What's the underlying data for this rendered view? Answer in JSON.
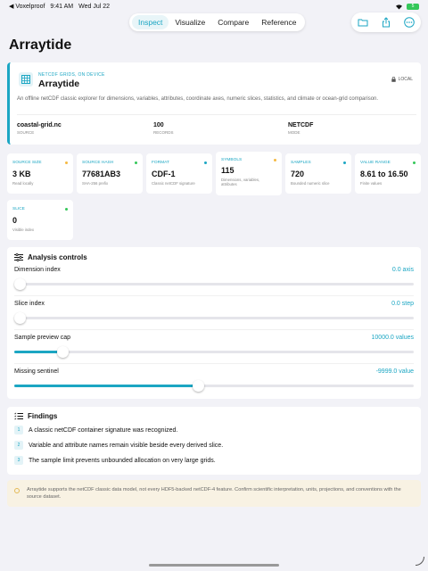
{
  "status": {
    "back": "◀ Voxelproof",
    "time": "9:41 AM",
    "date": "Wed Jul 22",
    "battery": "5"
  },
  "tabs": [
    "Inspect",
    "Visualize",
    "Compare",
    "Reference"
  ],
  "page": {
    "title": "Arraytide"
  },
  "hero": {
    "eyebrow": "NETCDF GRIDS, ON DEVICE",
    "title": "Arraytide",
    "badge": "LOCAL",
    "description": "An offline netCDF classic explorer for dimensions, variables, attributes, coordinate axes, numeric slices, statistics, and climate or ocean-grid comparison.",
    "meta": [
      {
        "value": "coastal-grid.nc",
        "label": "SOURCE"
      },
      {
        "value": "100",
        "label": "RECORDS"
      },
      {
        "value": "NETCDF",
        "label": "MODE"
      }
    ]
  },
  "stats": [
    {
      "label": "SOURCE SIZE",
      "value": "3 KB",
      "sub": "Read locally",
      "dot": "#f5b942"
    },
    {
      "label": "SOURCE HASH",
      "value": "77681AB3",
      "sub": "SHA-256 prefix",
      "dot": "#34c759"
    },
    {
      "label": "FORMAT",
      "value": "CDF-1",
      "sub": "Classic netCDF signature",
      "dot": "#1ba6c3"
    },
    {
      "label": "SYMBOLS",
      "value": "115",
      "sub": "Dimensions, variables, attributes",
      "dot": "#f5b942"
    },
    {
      "label": "SAMPLES",
      "value": "720",
      "sub": "Bounded numeric slice",
      "dot": "#1ba6c3"
    },
    {
      "label": "VALUE RANGE",
      "value": "8.61 to 16.50",
      "sub": "Finite values",
      "dot": "#34c759"
    },
    {
      "label": "SLICE",
      "value": "0",
      "sub": "Visible index",
      "dot": "#34c759"
    }
  ],
  "controls": {
    "title": "Analysis controls",
    "items": [
      {
        "name": "Dimension index",
        "value": "0.0 axis",
        "level": 0.0
      },
      {
        "name": "Slice index",
        "value": "0.0 step",
        "level": 0.0
      },
      {
        "name": "Sample preview cap",
        "value": "10000.0 values",
        "level": 0.12
      },
      {
        "name": "Missing sentinel",
        "value": "-9999.0 value",
        "level": 0.46
      }
    ]
  },
  "findings": {
    "title": "Findings",
    "items": [
      {
        "n": "1",
        "text": "A classic netCDF container signature was recognized."
      },
      {
        "n": "2",
        "text": "Variable and attribute names remain visible beside every derived slice."
      },
      {
        "n": "3",
        "text": "The sample limit prevents unbounded allocation on very large grids."
      }
    ]
  },
  "notice": "Arraytide supports the netCDF classic data model, not every HDF5-backed netCDF-4 feature. Confirm scientific interpretation, units, projections, and conventions with the source dataset.",
  "colors": {
    "accent": "#1ba6c3",
    "background": "#f2f2f7"
  }
}
